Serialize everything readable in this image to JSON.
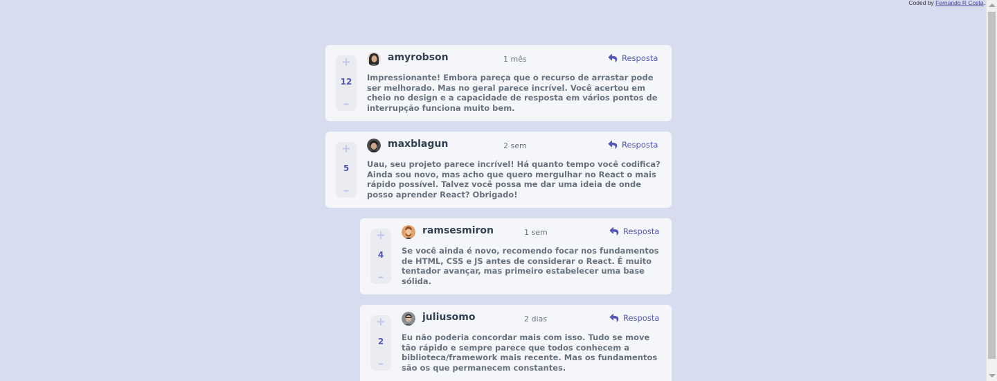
{
  "attribution": {
    "prefix": "Coded by ",
    "author": "Fernando R Costa",
    "suffix": "."
  },
  "reply_label": "Resposta",
  "comments": [
    {
      "username": "amyrobson",
      "time": "1 mês",
      "score": "12",
      "avatar_color": "#2a2a2a",
      "content": "Impressionante! Embora pareça que o recurso de arrastar pode ser melhorado. Mas no geral parece incrível. Você acertou em cheio no design e a capacidade de resposta em vários pontos de interrupção funciona muito bem."
    },
    {
      "username": "maxblagun",
      "time": "2 sem",
      "score": "5",
      "avatar_color": "#3b3b3b",
      "content": "Uau, seu projeto parece incrível! Há quanto tempo você codifica? Ainda sou novo, mas acho que quero mergulhar no React o mais rápido possível. Talvez você possa me dar uma ideia de onde posso aprender React? Obrigado!"
    },
    {
      "username": "ramsesmiron",
      "time": "1 sem",
      "score": "4",
      "avatar_color": "#c78a4c",
      "content": "Se você ainda é novo, recomendo focar nos fundamentos de HTML, CSS e JS antes de considerar o React. É muito tentador avançar, mas primeiro estabelecer uma base sólida."
    },
    {
      "username": "juliusomo",
      "time": "2 dias",
      "score": "2",
      "avatar_color": "#6b6b6b",
      "content": "Eu não poderia concordar mais com isso. Tudo se move tão rápido e sempre parece que todos conhecem a biblioteca/framework mais recente. Mas os fundamentos são os que permanecem constantes."
    }
  ],
  "colors": {
    "background": "#d8dcef",
    "card": "#f5f6fa",
    "accent": "#5357b6",
    "vote_icon": "#c5c6ef",
    "username": "#334253",
    "text": "#67727e"
  },
  "icons": {
    "upvote": "plus-icon",
    "downvote": "minus-icon",
    "reply": "reply-arrow-icon"
  }
}
